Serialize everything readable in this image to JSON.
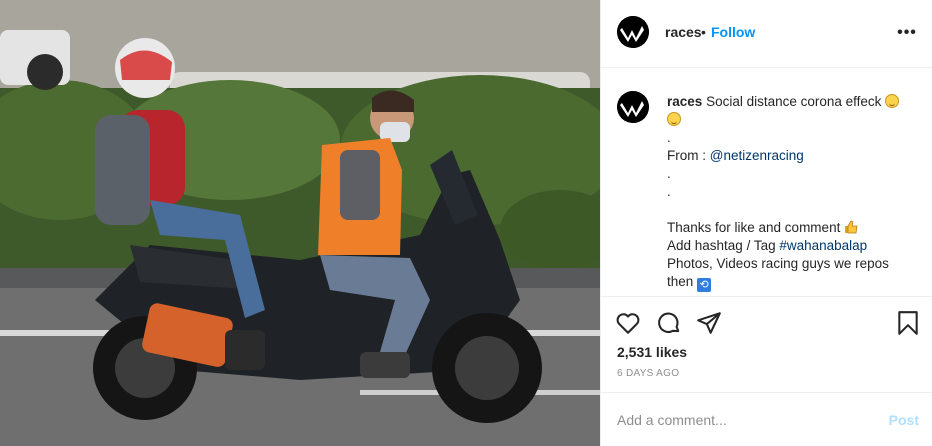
{
  "photo": {
    "alt_subject": "scooter-riders-photo"
  },
  "header": {
    "username": "races",
    "separator": "•",
    "follow_label": "Follow",
    "more_icon": "more-horizontal-icon"
  },
  "caption": {
    "username": "races",
    "lines": [
      "Social distance corona effeck",
      ".",
      "From :",
      ".",
      ".",
      "",
      "Thanks for like and comment",
      "Add hashtag / Tag",
      "Photos, Videos racing guys we repos",
      "then"
    ],
    "mention": "@netizenracing",
    "hashtag": "#wahanabalap"
  },
  "actions": {
    "like_icon": "heart-icon",
    "comment_icon": "comment-icon",
    "share_icon": "paper-plane-icon",
    "save_icon": "bookmark-icon"
  },
  "stats": {
    "likes": "2,531 likes",
    "time_ago": "6 DAYS AGO"
  },
  "comment": {
    "placeholder": "Add a comment...",
    "post_label": "Post"
  },
  "colors": {
    "accent": "#0095f6",
    "post_disabled": "#b2dffc",
    "text": "#262626",
    "muted": "#8e8e8e"
  }
}
